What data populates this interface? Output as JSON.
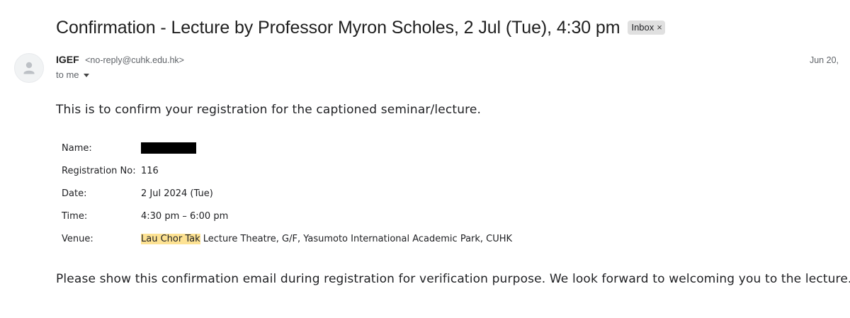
{
  "email": {
    "subject": "Confirmation - Lecture by Professor Myron Scholes, 2 Jul (Tue), 4:30 pm",
    "label": "Inbox",
    "label_remove": "×",
    "sender_name": "IGEF",
    "sender_email": "<no-reply@cuhk.edu.hk>",
    "recipient": "to me",
    "date": "Jun 20,"
  },
  "body": {
    "intro": "This is to confirm your registration for the captioned seminar/lecture.",
    "details": [
      {
        "label": "Name:",
        "value": "",
        "redacted": true
      },
      {
        "label": "Registration No:",
        "value": "116"
      },
      {
        "label": "Date:",
        "value": "2 Jul 2024 (Tue)"
      },
      {
        "label": "Time:",
        "value": "4:30 pm – 6:00 pm"
      },
      {
        "label": "Venue:",
        "value_highlight": "Lau Chor Tak",
        "value_rest": " Lecture Theatre, G/F, Yasumoto International Academic Park, CUHK"
      }
    ],
    "outro": "Please show this confirmation email during registration for verification purpose. We look forward to welcoming you to the lecture."
  },
  "icons": {
    "avatar": "default-person-icon",
    "recipient_menu": "caret-down-icon",
    "label_close": "close-icon"
  },
  "colors": {
    "highlight": "#fde293",
    "chip_background": "#e0e0e0",
    "redaction": "#000000"
  }
}
